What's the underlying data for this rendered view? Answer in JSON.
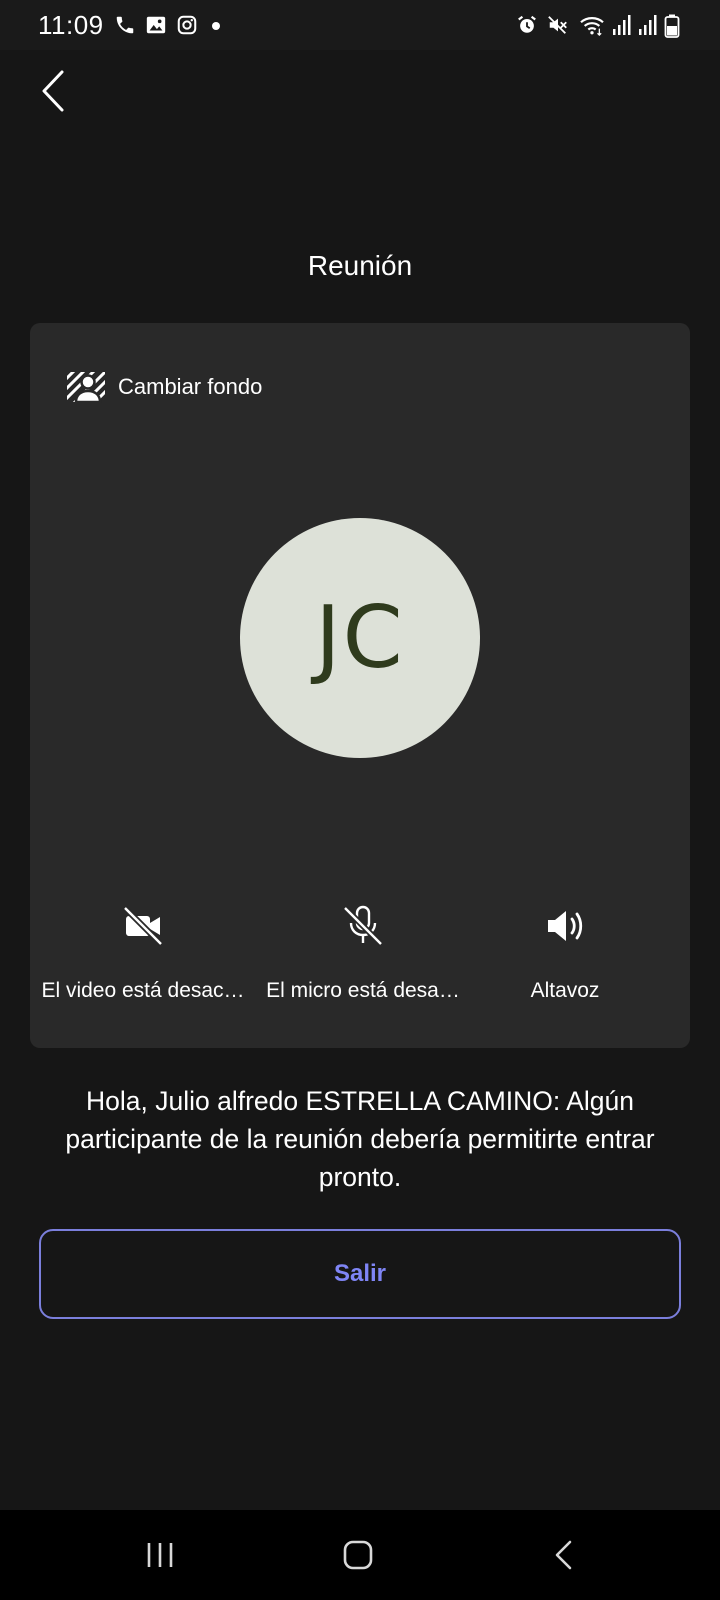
{
  "status_bar": {
    "time": "11:09",
    "left_icons": [
      "phone-icon",
      "gallery-icon",
      "instagram-icon",
      "dot-icon"
    ],
    "right_icons": [
      "alarm-icon",
      "mute-icon",
      "wifi-icon",
      "signal-icon",
      "signal-icon",
      "battery-icon"
    ]
  },
  "header": {
    "back_icon": "chevron-left-icon",
    "title": "Reunión"
  },
  "preview": {
    "change_background_label": "Cambiar fondo",
    "avatar_initials": "JC",
    "avatar_bg_color": "#dde1d8",
    "avatar_text_color": "#2f3b1d",
    "controls": [
      {
        "icon": "video-off-icon",
        "label": "El video está desac…"
      },
      {
        "icon": "mic-off-icon",
        "label": "El micro está desa…"
      },
      {
        "icon": "speaker-icon",
        "label": "Altavoz"
      }
    ]
  },
  "lobby_message": "Hola, Julio alfredo ESTRELLA CAMINO: Algún participante de la reunión debería permitirte entrar pronto.",
  "leave_button": {
    "label": "Salir",
    "accent_color": "#7f85f5"
  },
  "nav_bar": {
    "buttons": [
      "recents-icon",
      "home-icon",
      "back-icon"
    ]
  }
}
